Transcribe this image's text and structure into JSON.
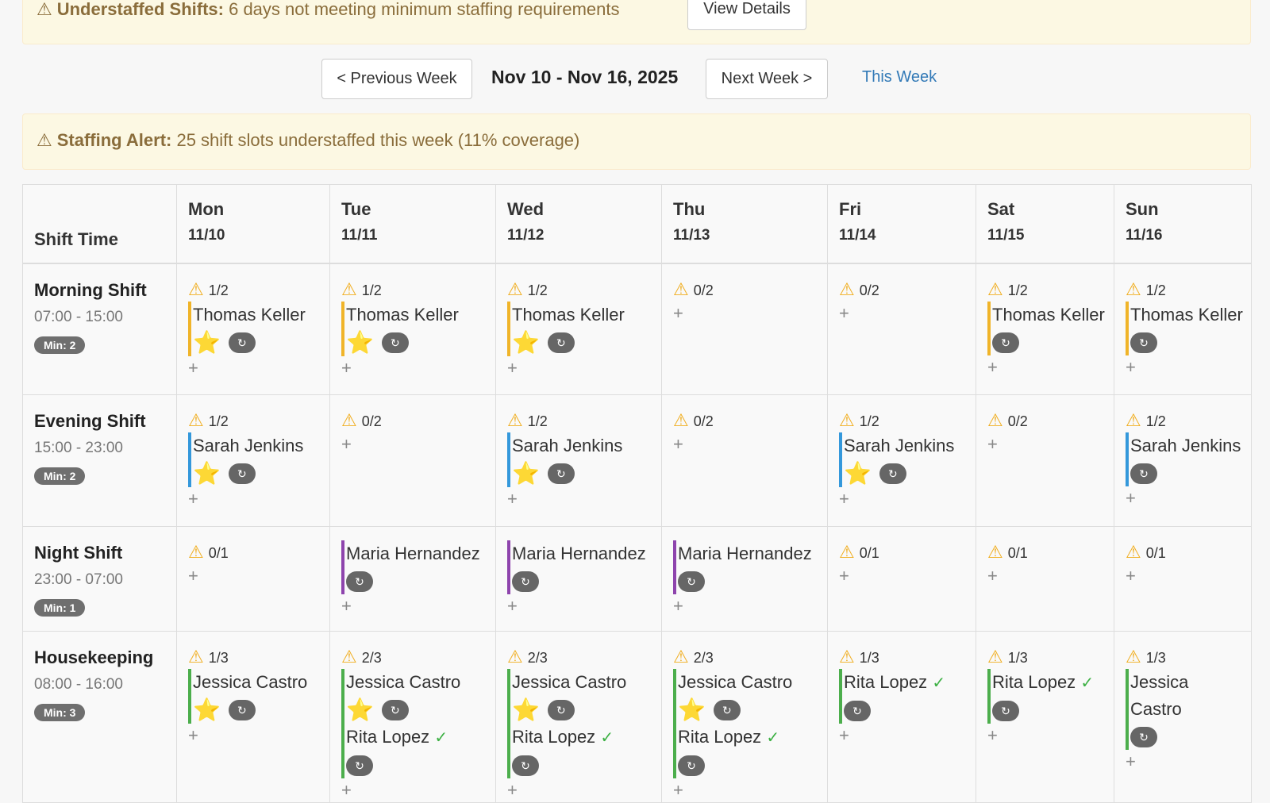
{
  "alerts": {
    "top": {
      "icon": "warning-icon",
      "title": "Understaffed Shifts:",
      "text": " 6 days not meeting minimum staffing requirements",
      "button": "View Details"
    },
    "staffing": {
      "icon": "warning-icon",
      "title": "Staffing Alert:",
      "text": " 25 shift slots understaffed this week (11% coverage)"
    }
  },
  "nav": {
    "prev": "< Previous Week",
    "range": "Nov 10 - Nov 16, 2025",
    "next": "Next Week >",
    "this_week": "This Week"
  },
  "table": {
    "shift_header": "Shift Time",
    "days": [
      {
        "name": "Mon",
        "date": "11/10"
      },
      {
        "name": "Tue",
        "date": "11/11"
      },
      {
        "name": "Wed",
        "date": "11/12"
      },
      {
        "name": "Thu",
        "date": "11/13"
      },
      {
        "name": "Fri",
        "date": "11/14"
      },
      {
        "name": "Sat",
        "date": "11/15"
      },
      {
        "name": "Sun",
        "date": "11/16"
      }
    ],
    "shifts": [
      {
        "name": "Morning Shift",
        "time": "07:00 - 15:00",
        "min": "Min: 2",
        "kind": "morning",
        "cells": [
          {
            "count": "1/2",
            "warn": true,
            "people": [
              {
                "name": "Thomas Keller",
                "star": true
              }
            ]
          },
          {
            "count": "1/2",
            "warn": true,
            "people": [
              {
                "name": "Thomas Keller",
                "star": true
              }
            ]
          },
          {
            "count": "1/2",
            "warn": true,
            "people": [
              {
                "name": "Thomas Keller",
                "star": true
              }
            ]
          },
          {
            "count": "0/2",
            "warn": true,
            "people": []
          },
          {
            "count": "0/2",
            "warn": true,
            "people": []
          },
          {
            "count": "1/2",
            "warn": true,
            "people": [
              {
                "name": "Thomas Keller",
                "star": false
              }
            ]
          },
          {
            "count": "1/2",
            "warn": true,
            "people": [
              {
                "name": "Thomas Keller",
                "star": false
              }
            ]
          }
        ]
      },
      {
        "name": "Evening Shift",
        "time": "15:00 - 23:00",
        "min": "Min: 2",
        "kind": "evening",
        "cells": [
          {
            "count": "1/2",
            "warn": true,
            "people": [
              {
                "name": "Sarah Jenkins",
                "star": true
              }
            ]
          },
          {
            "count": "0/2",
            "warn": true,
            "people": []
          },
          {
            "count": "1/2",
            "warn": true,
            "people": [
              {
                "name": "Sarah Jenkins",
                "star": true
              }
            ]
          },
          {
            "count": "0/2",
            "warn": true,
            "people": []
          },
          {
            "count": "1/2",
            "warn": true,
            "people": [
              {
                "name": "Sarah Jenkins",
                "star": true
              }
            ]
          },
          {
            "count": "0/2",
            "warn": true,
            "people": []
          },
          {
            "count": "1/2",
            "warn": true,
            "people": [
              {
                "name": "Sarah Jenkins",
                "star": false
              }
            ]
          }
        ]
      },
      {
        "name": "Night Shift",
        "time": "23:00 - 07:00",
        "min": "Min: 1",
        "kind": "night",
        "cells": [
          {
            "count": "0/1",
            "warn": true,
            "people": []
          },
          {
            "count": "",
            "warn": false,
            "people": [
              {
                "name": "Maria Hernandez",
                "star": false
              }
            ]
          },
          {
            "count": "",
            "warn": false,
            "people": [
              {
                "name": "Maria Hernandez",
                "star": false
              }
            ]
          },
          {
            "count": "",
            "warn": false,
            "people": [
              {
                "name": "Maria Hernandez",
                "star": false
              }
            ]
          },
          {
            "count": "0/1",
            "warn": true,
            "people": []
          },
          {
            "count": "0/1",
            "warn": true,
            "people": []
          },
          {
            "count": "0/1",
            "warn": true,
            "people": []
          }
        ]
      },
      {
        "name": "Housekeeping",
        "time": "08:00 - 16:00",
        "min": "Min: 3",
        "kind": "house",
        "cells": [
          {
            "count": "1/3",
            "warn": true,
            "people": [
              {
                "name": "Jessica Castro",
                "star": true
              }
            ]
          },
          {
            "count": "2/3",
            "warn": true,
            "people": [
              {
                "name": "Jessica Castro",
                "star": true
              },
              {
                "name": "Rita Lopez",
                "check": true
              }
            ]
          },
          {
            "count": "2/3",
            "warn": true,
            "people": [
              {
                "name": "Jessica Castro",
                "star": true
              },
              {
                "name": "Rita Lopez",
                "check": true
              }
            ]
          },
          {
            "count": "2/3",
            "warn": true,
            "people": [
              {
                "name": "Jessica Castro",
                "star": true
              },
              {
                "name": "Rita Lopez",
                "check": true
              }
            ]
          },
          {
            "count": "1/3",
            "warn": true,
            "people": [
              {
                "name": "Rita Lopez",
                "check": true
              }
            ]
          },
          {
            "count": "1/3",
            "warn": true,
            "people": [
              {
                "name": "Rita Lopez",
                "check": true
              }
            ]
          },
          {
            "count": "1/3",
            "warn": true,
            "people": [
              {
                "name": "Jessica Castro",
                "star": false
              }
            ]
          }
        ]
      }
    ]
  },
  "glyphs": {
    "warn": "⚠",
    "star": "⭐",
    "swap": "↻",
    "check": "✓",
    "add": "+"
  },
  "colors": {
    "alert_bg": "#fcf8e3",
    "alert_text": "#8a6d3b",
    "link": "#337ab7",
    "warn": "#f0ad1e",
    "morning": "#f0b429",
    "evening": "#3498db",
    "night": "#8e44ad",
    "house": "#4cae4c",
    "check": "#3cb043"
  }
}
